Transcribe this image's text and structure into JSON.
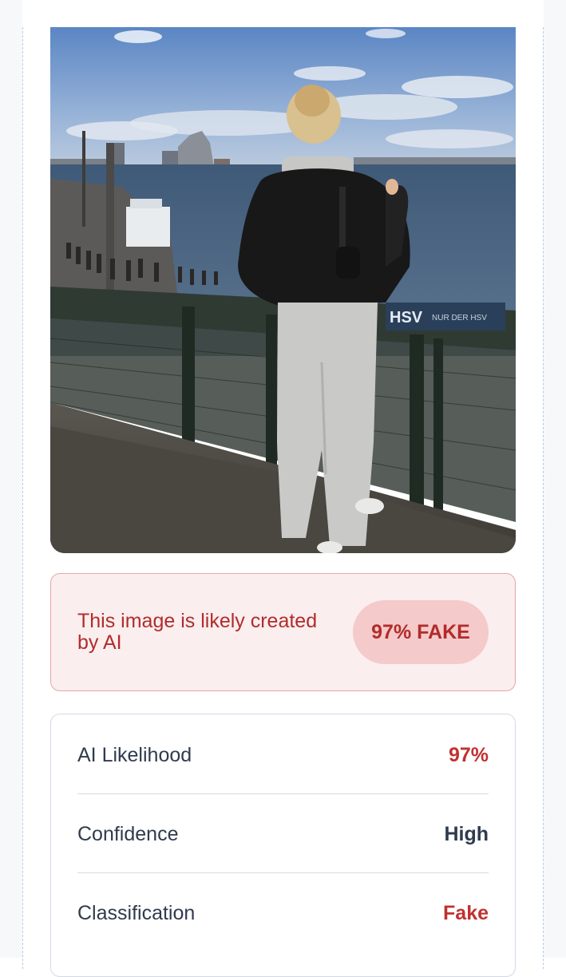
{
  "analyzed_image": {
    "description_icon": "photo-icon"
  },
  "verdict": {
    "message": "This image is likely created by AI",
    "badge": "97% FAKE",
    "color": "#b12c2c"
  },
  "stats": [
    {
      "label": "AI Likelihood",
      "value": "97%",
      "color": "#c0312f"
    },
    {
      "label": "Confidence",
      "value": "High",
      "color": "#2f3b4d"
    },
    {
      "label": "Classification",
      "value": "Fake",
      "color": "#c0312f"
    }
  ],
  "photo_sign_text": {
    "logo": "HSV",
    "sign": "NUR DER HSV"
  }
}
